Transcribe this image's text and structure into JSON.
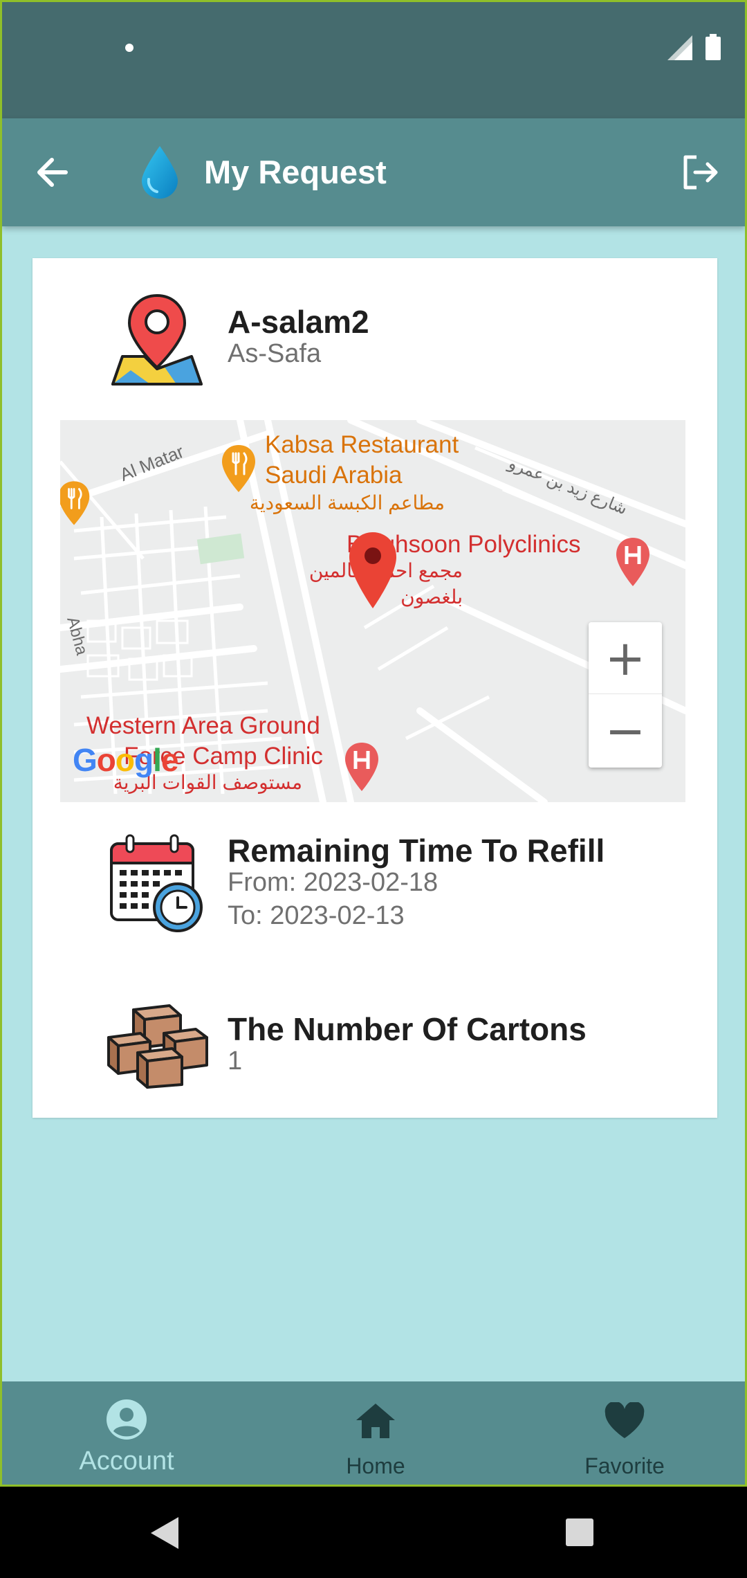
{
  "app_bar": {
    "title": "My Request"
  },
  "location": {
    "name": "A-salam2",
    "district": "As-Safa"
  },
  "map": {
    "labels": {
      "kabsa_en": "Kabsa Restaurant",
      "kabsa_en2": "Saudi Arabia",
      "kabsa_ar": "مطاعم الكبسة السعودية",
      "al_matar": "Al Matar",
      "street_ar": "شارع زيد بن عمرو",
      "poly_en": "Balghsoon Polyclinics",
      "poly_ar1": "مجمع احمد سالمين",
      "poly_ar2": "بلغصون",
      "abha": "Abha",
      "western_1": "Western Area Ground",
      "western_2": "Force Camp Clinic",
      "western_ar": "مستوصف القوات البرية"
    },
    "zoom_in": "+",
    "zoom_out": "−",
    "attribution": "Google"
  },
  "refill": {
    "title": "Remaining Time To Refill",
    "from": "From: 2023-02-18",
    "to": "To: 2023-02-13"
  },
  "cartons": {
    "title": "The Number Of Cartons",
    "count": "1"
  },
  "bottom_nav": {
    "items": [
      {
        "label": "Account",
        "icon": "account-icon",
        "active": true
      },
      {
        "label": "Home",
        "icon": "home-icon",
        "active": false
      },
      {
        "label": "Favorite",
        "icon": "heart-icon",
        "active": false
      }
    ]
  },
  "colors": {
    "status_bar": "#456b6e",
    "app_bar": "#568c8f",
    "background": "#b2e3e5",
    "nav_active": "#b2e3e5",
    "nav_inactive": "#1e3d3f"
  }
}
